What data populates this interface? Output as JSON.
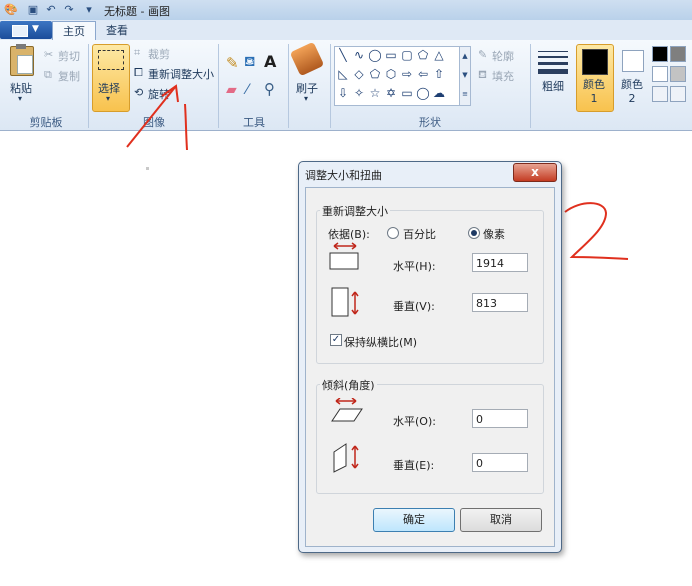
{
  "window": {
    "title": "无标题 - 画图"
  },
  "tabs": [
    {
      "label": "主页"
    },
    {
      "label": "查看"
    }
  ],
  "ribbon": {
    "clipboard": {
      "paste": "粘贴",
      "cut": "剪切",
      "copy": "复制",
      "label": "剪贴板"
    },
    "image": {
      "select": "选择",
      "crop": "裁剪",
      "resize": "重新调整大小",
      "rotate": "旋转",
      "label": "图像"
    },
    "tools": {
      "label": "工具"
    },
    "brushes": {
      "label": "刷子"
    },
    "shapes": {
      "outline": "轮廓",
      "fill": "填充",
      "label": "形状"
    },
    "size": {
      "label": "粗细"
    },
    "color1": {
      "label": "颜色 1"
    },
    "color2": {
      "label": "颜色 2"
    }
  },
  "dialog": {
    "title": "调整大小和扭曲",
    "close": "x",
    "resize_section": "重新调整大小",
    "by_label": "依据(B):",
    "percent_label": "百分比",
    "pixels_label": "像素",
    "horizontal_label": "水平(H):",
    "horizontal_value": "1914",
    "vertical_label": "垂直(V):",
    "vertical_value": "813",
    "keep_ratio_label": "保持纵横比(M)",
    "skew_section": "倾斜(角度)",
    "skew_h_label": "水平(O):",
    "skew_h_value": "0",
    "skew_v_label": "垂直(E):",
    "skew_v_value": "0",
    "ok": "确定",
    "cancel": "取消"
  },
  "colors": {
    "accent_red": "#e0301e",
    "ribbon_bg": "#dce7f4",
    "color1": "#000000",
    "color2": "#ffffff"
  },
  "annotations": {
    "mark1": "1",
    "mark2": "2"
  }
}
